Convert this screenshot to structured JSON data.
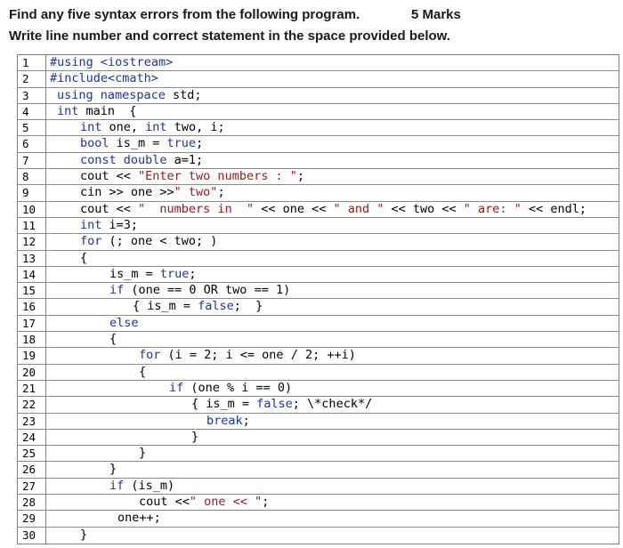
{
  "header": {
    "instruction": "Find any five syntax errors from the following program.",
    "marks": "5 Marks",
    "subinstruction": "Write line number and correct statement in the space provided below."
  },
  "colors": {
    "keyword": "#1f33a8",
    "string": "#a01a1a",
    "text": "#000000",
    "border": "#808080"
  },
  "lines": [
    {
      "num": "1",
      "indent": 4,
      "parts": [
        [
          "k",
          "#using"
        ],
        [
          "p",
          " "
        ],
        [
          "k",
          "<iostream>"
        ]
      ]
    },
    {
      "num": "2",
      "indent": 4,
      "parts": [
        [
          "k",
          "#include<cmath>"
        ]
      ]
    },
    {
      "num": "3",
      "indent": 12,
      "parts": [
        [
          "k",
          "using namespace"
        ],
        [
          "p",
          " std;"
        ]
      ]
    },
    {
      "num": "4",
      "indent": 12,
      "parts": [
        [
          "k",
          "int"
        ],
        [
          "p",
          " main  {"
        ]
      ]
    },
    {
      "num": "5",
      "indent": 38,
      "parts": [
        [
          "k",
          "int"
        ],
        [
          "p",
          " one, "
        ],
        [
          "k",
          "int"
        ],
        [
          "p",
          " two, i;"
        ]
      ]
    },
    {
      "num": "6",
      "indent": 38,
      "parts": [
        [
          "k",
          "bool"
        ],
        [
          "p",
          " is_m = "
        ],
        [
          "k",
          "true"
        ],
        [
          "p",
          ";"
        ]
      ]
    },
    {
      "num": "7",
      "indent": 38,
      "parts": [
        [
          "k",
          "const double"
        ],
        [
          "p",
          " a=1;"
        ]
      ]
    },
    {
      "num": "8",
      "indent": 38,
      "parts": [
        [
          "p",
          "cout << "
        ],
        [
          "s",
          "\"Enter two numbers : \""
        ],
        [
          "p",
          ";"
        ]
      ]
    },
    {
      "num": "9",
      "indent": 38,
      "parts": [
        [
          "p",
          "cin >> one >>"
        ],
        [
          "s",
          "\" two\""
        ],
        [
          "p",
          ";"
        ]
      ]
    },
    {
      "num": "10",
      "indent": 38,
      "parts": [
        [
          "p",
          "cout << "
        ],
        [
          "s",
          "\"  numbers in  \""
        ],
        [
          "p",
          " << one << "
        ],
        [
          "s",
          "\" and \""
        ],
        [
          "p",
          " << two << "
        ],
        [
          "s",
          "\" are: \""
        ],
        [
          "p",
          " << endl;"
        ]
      ]
    },
    {
      "num": "11",
      "indent": 38,
      "parts": [
        [
          "k",
          "int"
        ],
        [
          "p",
          " i=3;"
        ]
      ]
    },
    {
      "num": "12",
      "indent": 38,
      "parts": [
        [
          "k",
          "for"
        ],
        [
          "p",
          " (; one < two; )"
        ]
      ]
    },
    {
      "num": "13",
      "indent": 38,
      "parts": [
        [
          "p",
          "{"
        ]
      ]
    },
    {
      "num": "14",
      "indent": 71,
      "parts": [
        [
          "p",
          "is_m = "
        ],
        [
          "k",
          "true"
        ],
        [
          "p",
          ";"
        ]
      ]
    },
    {
      "num": "15",
      "indent": 71,
      "parts": [
        [
          "k",
          "if"
        ],
        [
          "p",
          " (one == 0 OR two == 1)"
        ]
      ]
    },
    {
      "num": "16",
      "indent": 97,
      "parts": [
        [
          "p",
          "{ is_m = "
        ],
        [
          "k",
          "false"
        ],
        [
          "p",
          ";  }"
        ]
      ]
    },
    {
      "num": "17",
      "indent": 71,
      "parts": [
        [
          "k",
          "else"
        ]
      ]
    },
    {
      "num": "18",
      "indent": 71,
      "parts": [
        [
          "p",
          "{"
        ]
      ]
    },
    {
      "num": "19",
      "indent": 104,
      "parts": [
        [
          "k",
          "for"
        ],
        [
          "p",
          " (i = 2; i <= one / 2; ++i)"
        ]
      ]
    },
    {
      "num": "20",
      "indent": 104,
      "parts": [
        [
          "p",
          "{"
        ]
      ]
    },
    {
      "num": "21",
      "indent": 138,
      "parts": [
        [
          "k",
          "if"
        ],
        [
          "p",
          " (one % i == 0)"
        ]
      ]
    },
    {
      "num": "22",
      "indent": 163,
      "parts": [
        [
          "p",
          "{ is_m = "
        ],
        [
          "k",
          "false"
        ],
        [
          "p",
          "; \\*check*/"
        ]
      ]
    },
    {
      "num": "23",
      "indent": 180,
      "parts": [
        [
          "k",
          "break"
        ],
        [
          "p",
          ";"
        ]
      ]
    },
    {
      "num": "24",
      "indent": 163,
      "parts": [
        [
          "p",
          "}"
        ]
      ]
    },
    {
      "num": "25",
      "indent": 104,
      "parts": [
        [
          "p",
          "}"
        ]
      ]
    },
    {
      "num": "26",
      "indent": 71,
      "parts": [
        [
          "p",
          "}"
        ]
      ]
    },
    {
      "num": "27",
      "indent": 71,
      "parts": [
        [
          "k",
          "if"
        ],
        [
          "p",
          " (is_m)"
        ]
      ]
    },
    {
      "num": "28",
      "indent": 104,
      "parts": [
        [
          "p",
          "cout <<"
        ],
        [
          "s",
          "\" one << \""
        ],
        [
          "p",
          ";"
        ]
      ]
    },
    {
      "num": "29",
      "indent": 80,
      "parts": [
        [
          "p",
          "one++;"
        ]
      ]
    },
    {
      "num": "30",
      "indent": 38,
      "parts": [
        [
          "p",
          "}"
        ]
      ]
    }
  ]
}
